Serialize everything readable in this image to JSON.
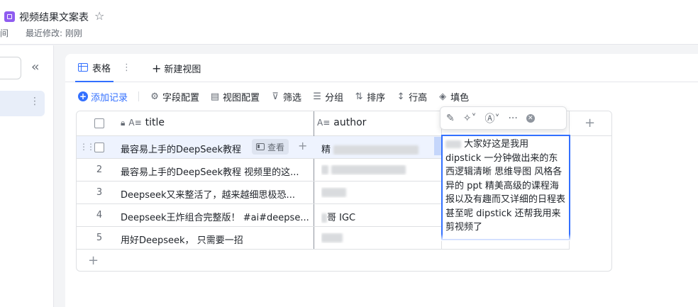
{
  "header": {
    "doc_title": "视频结果文案表",
    "sub_left": "间",
    "last_modified": "最近修改: 刚刚"
  },
  "tabs": {
    "active_label": "表格",
    "new_view_label": "新建视图"
  },
  "toolbar": {
    "add_record": "添加记录",
    "field_config": "字段配置",
    "view_config": "视图配置",
    "filter": "筛选",
    "group": "分组",
    "sort": "排序",
    "row_height": "行高",
    "fill": "填色"
  },
  "table": {
    "columns": [
      {
        "label": "title"
      },
      {
        "label": "author"
      }
    ],
    "view_button": "查看",
    "rows": [
      {
        "index": "",
        "title": "最容易上手的DeepSeek教程",
        "author": "精"
      },
      {
        "index": "2",
        "title": "最容易上手的DeepSeek教程 视频里的这...",
        "author": ""
      },
      {
        "index": "3",
        "title": "Deepseek又来整活了，越来越细思极恐...",
        "author": ""
      },
      {
        "index": "4",
        "title": "Deepseek王炸组合完整版！ #ai#deepse...",
        "author": "哥 IGC"
      },
      {
        "index": "5",
        "title": "用好Deepseek， 只需要一招",
        "author": ""
      }
    ]
  },
  "editor": {
    "text": "大家好这是我用 dipstick 一分钟做出来的东西逻辑清晰 思维导图 风格各异的 ppt 精美高级的课程海报以及有趣而又详细的日程表甚至呢 dipstick 还帮我用来剪视频了"
  },
  "colors": {
    "accent": "#3370ff",
    "doc_icon": "#8f5cf0"
  }
}
